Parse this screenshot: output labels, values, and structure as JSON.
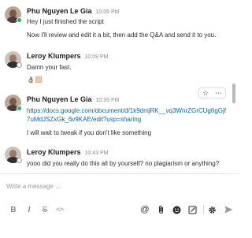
{
  "messages": [
    {
      "author": "Phu Nguyen Le Gia",
      "time": "10:06 PM",
      "lines": [
        "Hey I just finished the script",
        "Now I'll review and edit it a bit, then add the Q&A and send it to you."
      ]
    },
    {
      "author": "Leroy Klumpers",
      "time": "10:09 PM",
      "lines": [
        "Damn your fast."
      ],
      "reactions": "👌🏽"
    },
    {
      "author": "Phu Nguyen Le Gia",
      "time": "10:39 PM",
      "link": "https://docs.google.com/document/d/1k9dmjRK__vq3WnrZGrCUg6gGjf7uMdJSZxGk_6v9KAE/edit?usp=sharing",
      "lines": [
        "I will wait to tweak if you don't like something"
      ]
    },
    {
      "author": "Leroy Klumpers",
      "time": "10:43 PM",
      "lines": [
        "yooo did you really do this all by yourself? no plagiarism or anything?"
      ]
    }
  ],
  "composer": {
    "placeholder": "Write a message ..."
  },
  "toolbar": {
    "bold": "B",
    "italic": "I",
    "strike": "S",
    "code": "</>",
    "mention": "@"
  }
}
